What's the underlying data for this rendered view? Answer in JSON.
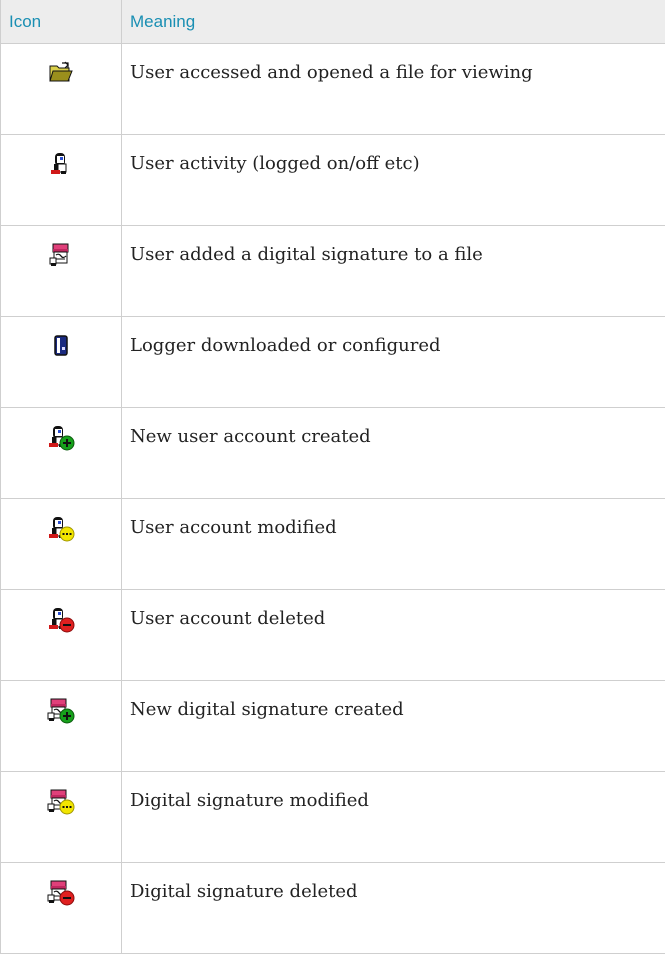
{
  "header": {
    "icon": "Icon",
    "meaning": "Meaning"
  },
  "rows": [
    {
      "icon": "open-folder-icon",
      "meaning": "User accessed and opened a file for viewing"
    },
    {
      "icon": "user-icon",
      "meaning": "User activity (logged on/off etc)"
    },
    {
      "icon": "signature-icon",
      "meaning": "User added a digital signature to a file"
    },
    {
      "icon": "logger-icon",
      "meaning": "Logger downloaded or configured"
    },
    {
      "icon": "user-add-icon",
      "meaning": "New user account created"
    },
    {
      "icon": "user-modify-icon",
      "meaning": "User account modified"
    },
    {
      "icon": "user-delete-icon",
      "meaning": "User account deleted"
    },
    {
      "icon": "signature-add-icon",
      "meaning": "New digital signature created"
    },
    {
      "icon": "signature-modify-icon",
      "meaning": "Digital signature modified"
    },
    {
      "icon": "signature-delete-icon",
      "meaning": "Digital signature deleted"
    }
  ],
  "colors": {
    "header_bg": "#ededed",
    "header_text": "#1a8fb3",
    "border": "#cfcfcf",
    "add_badge": "#16a01b",
    "modify_badge": "#f2e600",
    "delete_badge": "#e02020",
    "signature_pink": "#e0407a"
  }
}
